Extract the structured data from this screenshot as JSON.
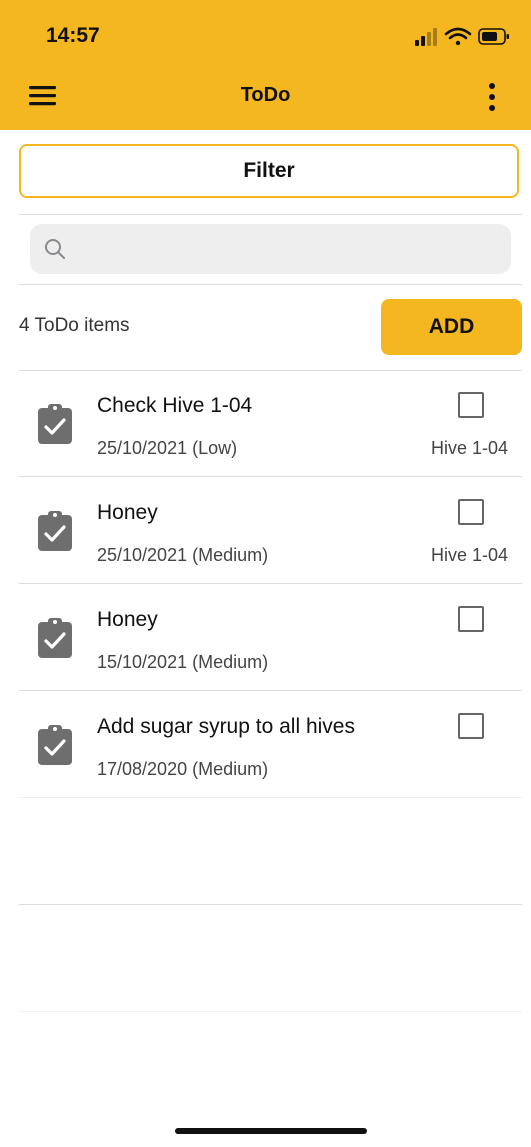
{
  "status_bar": {
    "time": "14:57"
  },
  "nav": {
    "title": "ToDo"
  },
  "filter": {
    "label": "Filter"
  },
  "search": {
    "placeholder": "",
    "value": ""
  },
  "toolbar": {
    "count_text": "4 ToDo items",
    "add_label": "ADD"
  },
  "colors": {
    "accent": "#f4b71f",
    "icon": "#6e6e6e",
    "separator": "#dcdcdc",
    "search_bg": "#eeeeef"
  },
  "items": [
    {
      "title": "Check Hive 1-04",
      "subtitle": "25/10/2021 (Low)",
      "hive": "Hive 1-04",
      "checked": false,
      "icon": "clipboard-check-icon"
    },
    {
      "title": "Honey",
      "subtitle": "25/10/2021 (Medium)",
      "hive": "Hive 1-04",
      "checked": false,
      "icon": "clipboard-check-icon"
    },
    {
      "title": "Honey",
      "subtitle": "15/10/2021 (Medium)",
      "hive": "",
      "checked": false,
      "icon": "clipboard-check-icon"
    },
    {
      "title": "Add sugar syrup to all hives",
      "subtitle": "17/08/2020 (Medium)",
      "hive": "",
      "checked": false,
      "icon": "clipboard-check-icon"
    }
  ]
}
